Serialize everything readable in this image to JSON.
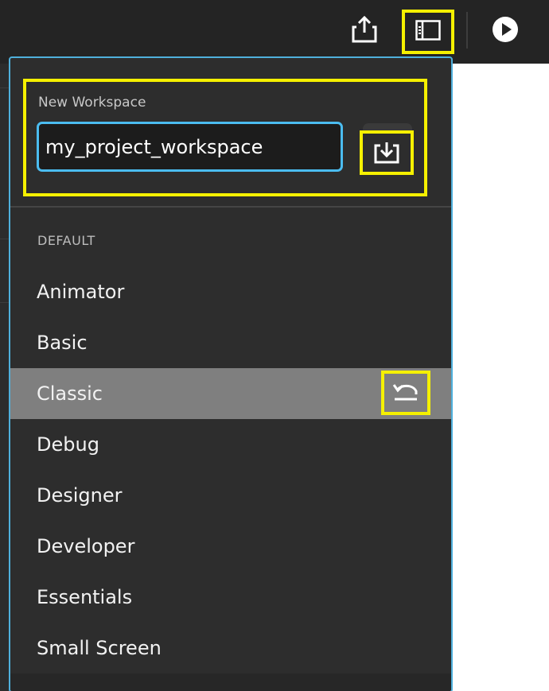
{
  "toolbar": {
    "icons": {
      "share": "share-export-icon",
      "workspace": "workspace-layout-icon",
      "play": "play-icon"
    }
  },
  "workspace_panel": {
    "new_workspace_label": "New Workspace",
    "new_workspace_value": "my_project_workspace",
    "save_icon": "save-download-icon",
    "section_header": "DEFAULT",
    "items": [
      {
        "label": "Animator"
      },
      {
        "label": "Basic"
      },
      {
        "label": "Classic",
        "selected": true
      },
      {
        "label": "Debug"
      },
      {
        "label": "Designer"
      },
      {
        "label": "Developer"
      },
      {
        "label": "Essentials"
      },
      {
        "label": "Small Screen"
      }
    ],
    "reset_icon": "reset-undo-icon"
  },
  "colors": {
    "highlight": "#f5f000",
    "input_border": "#4bbcf0",
    "panel_border": "#4fb0dc",
    "panel_bg": "#2d2d2d",
    "selected_row": "#7f7f7f",
    "topbar_bg": "#242424"
  }
}
